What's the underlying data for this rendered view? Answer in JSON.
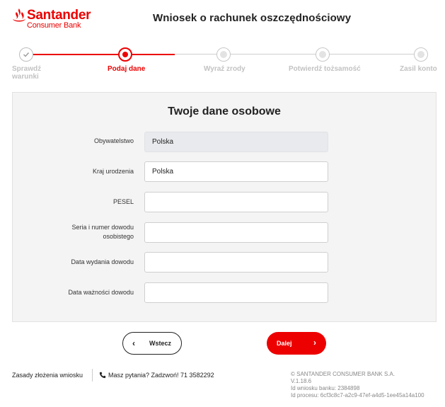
{
  "brand": {
    "name": "Santander",
    "sub": "Consumer Bank",
    "color": "#ec0000"
  },
  "header": {
    "title": "Wniosek o rachunek oszczędnościowy"
  },
  "stepper": {
    "steps": [
      {
        "label": "Sprawdź warunki",
        "state": "done"
      },
      {
        "label": "Podaj dane",
        "state": "active"
      },
      {
        "label": "Wyraź zrody",
        "state": "pending"
      },
      {
        "label": "Potwierdź tożsamość",
        "state": "pending"
      },
      {
        "label": "Zasil konto",
        "state": "pending"
      }
    ]
  },
  "form": {
    "title": "Twoje dane osobowe",
    "fields": [
      {
        "label": "Obywatelstwo",
        "value": "Polska",
        "readonly": true
      },
      {
        "label": "Kraj urodzenia",
        "value": "Polska",
        "readonly": false
      },
      {
        "label": "PESEL",
        "value": "",
        "readonly": false
      },
      {
        "label": "Seria i numer dowodu osobistego",
        "value": "",
        "readonly": false
      },
      {
        "label": "Data wydania dowodu",
        "value": "",
        "readonly": false
      },
      {
        "label": "Data ważności dowodu",
        "value": "",
        "readonly": false
      }
    ]
  },
  "actions": {
    "back_label": "Wstecz",
    "next_label": "Dalej"
  },
  "footer": {
    "rules_link": "Zasady złożenia wniosku",
    "phone_text": "Masz pytania? Zadzwoń! 71 3582292",
    "copyright": "© SANTANDER CONSUMER BANK S.A.",
    "version": "V.1.18.6",
    "bank_request_id": "Id wniosku banku: 2384898",
    "process_id": "Id procesu: 6cf3c8c7-a2c9-47ef-a4d5-1ee45a14a100"
  },
  "icons": {
    "logo": "flame-icon",
    "done_step": "checkmark-icon",
    "back": "chevron-left-icon",
    "next": "chevron-right-icon",
    "phone": "phone-icon"
  }
}
